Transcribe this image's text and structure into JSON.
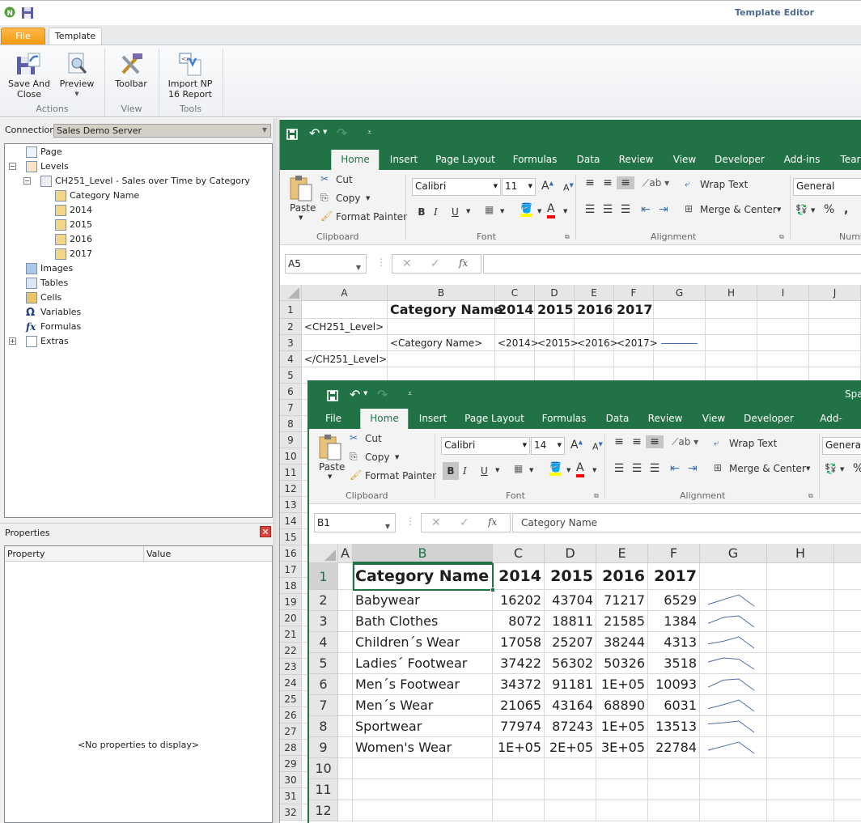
{
  "app": {
    "title": "Template Editor",
    "tabs": [
      "File",
      "Template"
    ],
    "ribbon": {
      "actions": {
        "label": "Actions",
        "save_and_close": [
          "Save And",
          "Close"
        ],
        "preview": "Preview"
      },
      "view": {
        "label": "View",
        "toolbar": "Toolbar"
      },
      "tools": {
        "label": "Tools",
        "import": [
          "Import NP",
          "16 Report"
        ]
      }
    }
  },
  "left": {
    "connection_label": "Connection",
    "connection_value": "Sales Demo Server",
    "tree": [
      {
        "label": "Page",
        "depth": 0,
        "icon": "page-icon"
      },
      {
        "label": "Levels",
        "depth": 0,
        "icon": "levels-icon",
        "toggle": "-"
      },
      {
        "label": "CH251_Level - Sales over Time by Category",
        "depth": 1,
        "icon": "level-icon",
        "toggle": "-"
      },
      {
        "label": "Category Name",
        "depth": 2,
        "icon": "field-icon"
      },
      {
        "label": "2014",
        "depth": 2,
        "icon": "field-icon"
      },
      {
        "label": "2015",
        "depth": 2,
        "icon": "field-icon"
      },
      {
        "label": "2016",
        "depth": 2,
        "icon": "field-icon"
      },
      {
        "label": "2017",
        "depth": 2,
        "icon": "field-icon"
      },
      {
        "label": "Images",
        "depth": 0,
        "icon": "image-icon"
      },
      {
        "label": "Tables",
        "depth": 0,
        "icon": "table-icon"
      },
      {
        "label": "Cells",
        "depth": 0,
        "icon": "cell-icon"
      },
      {
        "label": "Variables",
        "depth": 0,
        "icon": "omega-icon"
      },
      {
        "label": "Formulas",
        "depth": 0,
        "icon": "fx-icon"
      },
      {
        "label": "Extras",
        "depth": 0,
        "icon": "extras-icon",
        "toggle": "+"
      }
    ],
    "properties": {
      "title": "Properties",
      "columns": [
        "Property",
        "Value"
      ],
      "empty": "<No properties to display>"
    }
  },
  "colors": {
    "excel_green": "#217346",
    "sparkline": "#4a6fa5",
    "file_tab": "#f7a21b"
  },
  "outer_excel": {
    "tabs": [
      "",
      "Home",
      "Insert",
      "Page Layout",
      "Formulas",
      "Data",
      "Review",
      "View",
      "Developer",
      "Add-ins",
      "Tear"
    ],
    "active_tab": "Home",
    "ribbon": {
      "paste": "Paste",
      "cut": "Cut",
      "copy": "Copy",
      "format_painter": "Format Painter",
      "font_name": "Calibri",
      "font_size": "11",
      "wrap_text": "Wrap Text",
      "merge_center": "Merge & Center",
      "number_format": "General",
      "groups": [
        "Clipboard",
        "Font",
        "Alignment",
        "Number"
      ]
    },
    "name_box": "A5",
    "formula": "",
    "columns": [
      "A",
      "B",
      "C",
      "D",
      "E",
      "F",
      "G",
      "H",
      "I",
      "J"
    ],
    "row_numbers": [
      1,
      2,
      3,
      4,
      5,
      6,
      7,
      8,
      9,
      10,
      11,
      12,
      13,
      14,
      15,
      16,
      17,
      18,
      19,
      20,
      21,
      22,
      23,
      24,
      25,
      26,
      27,
      28,
      29,
      30,
      31,
      32
    ],
    "cells": [
      [
        "",
        "Category Name",
        "2014",
        "2015",
        "2016",
        "2017"
      ],
      [
        "<CH251_Level>",
        "",
        "",
        "",
        "",
        ""
      ],
      [
        "",
        "<Category Name>",
        "<2014>",
        "<2015>",
        "<2016>",
        "<2017>"
      ],
      [
        "</CH251_Level>",
        "",
        "",
        "",
        "",
        ""
      ]
    ],
    "sparkline_placeholder_row": 3
  },
  "inner_excel": {
    "title": "Spar",
    "tabs": [
      "File",
      "Home",
      "Insert",
      "Page Layout",
      "Formulas",
      "Data",
      "Review",
      "View",
      "Developer",
      "Add-ins"
    ],
    "active_tab": "Home",
    "ribbon": {
      "paste": "Paste",
      "cut": "Cut",
      "copy": "Copy",
      "format_painter": "Format Painter",
      "font_name": "Calibri",
      "font_size": "14",
      "wrap_text": "Wrap Text",
      "merge_center": "Merge & Center",
      "number_format": "General",
      "groups": [
        "Clipboard",
        "Font",
        "Alignment",
        "Nu"
      ]
    },
    "name_box": "B1",
    "formula": "Category Name",
    "columns": [
      "A",
      "B",
      "C",
      "D",
      "E",
      "F",
      "G",
      "H"
    ],
    "row_numbers": [
      1,
      2,
      3,
      4,
      5,
      6,
      7,
      8,
      9,
      10,
      11,
      12
    ],
    "header": [
      "Category Name",
      "2014",
      "2015",
      "2016",
      "2017"
    ],
    "rows": [
      {
        "name": "Babywear",
        "values": [
          "16202",
          "43704",
          "71217",
          "6529"
        ]
      },
      {
        "name": "Bath Clothes",
        "values": [
          "8072",
          "18811",
          "21585",
          "1384"
        ]
      },
      {
        "name": "Children´s Wear",
        "values": [
          "17058",
          "25207",
          "38244",
          "4313"
        ]
      },
      {
        "name": "Ladies´ Footwear",
        "values": [
          "37422",
          "56302",
          "50326",
          "3518"
        ]
      },
      {
        "name": "Men´s Footwear",
        "values": [
          "34372",
          "91181",
          "1E+05",
          "10093"
        ]
      },
      {
        "name": "Men´s Wear",
        "values": [
          "21065",
          "43164",
          "68890",
          "6031"
        ]
      },
      {
        "name": "Sportwear",
        "values": [
          "77974",
          "87243",
          "1E+05",
          "13513"
        ]
      },
      {
        "name": "Women's Wear",
        "values": [
          "1E+05",
          "2E+05",
          "3E+05",
          "22784"
        ]
      }
    ]
  }
}
